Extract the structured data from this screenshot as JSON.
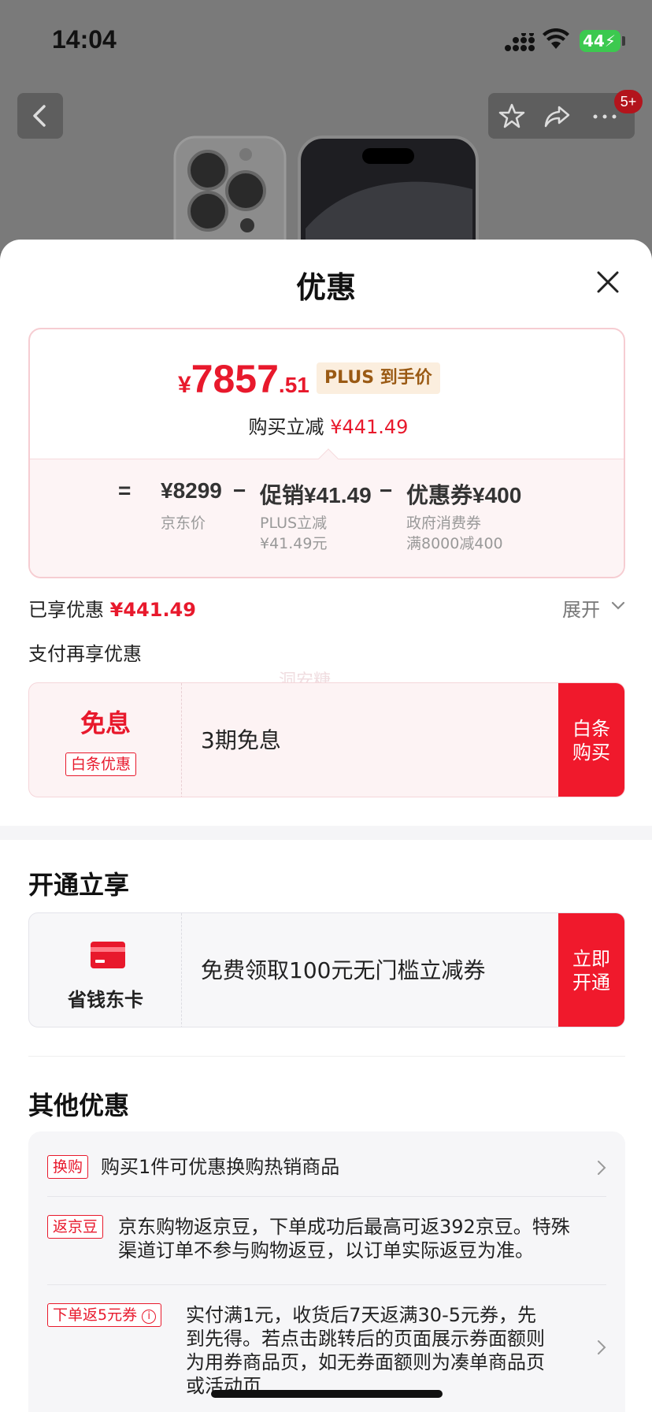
{
  "status": {
    "time": "14:04",
    "battery": "44"
  },
  "nav": {
    "badge": "5+"
  },
  "sheet": {
    "title": "优惠"
  },
  "price_card": {
    "symbol": "¥",
    "integer": "7857",
    "decimal": ".51",
    "plus_tag": "PLUS 到手价",
    "instant_cut_label": "购买立减",
    "instant_cut_value": "¥441.49",
    "eq": "=",
    "jd_price": "¥8299",
    "minus1": "−",
    "promo": "促销¥41.49",
    "minus2": "−",
    "coupon": "优惠券¥400",
    "jd_price_label": "京东价",
    "promo_sub1": "PLUS立减",
    "promo_sub2": "¥41.49元",
    "coupon_sub1": "政府消费券",
    "coupon_sub2": "满8000减400"
  },
  "enjoyed": {
    "label": "已享优惠",
    "value": "¥441.49",
    "expand": "展开"
  },
  "pay_more": {
    "title": "支付再享优惠",
    "watermark": "洞安糖"
  },
  "baitiao": {
    "title": "免息",
    "tag": "白条优惠",
    "desc": "3期免息",
    "button_l1": "白条",
    "button_l2": "购买"
  },
  "open_section": {
    "title": "开通立享"
  },
  "card_offer": {
    "label": "省钱东卡",
    "desc": "免费领取100元无门槛立减券",
    "button_l1": "立即",
    "button_l2": "开通"
  },
  "other_section": {
    "title": "其他优惠",
    "rows": [
      {
        "tag": "换购",
        "text": "购买1件可优惠换购热销商品"
      },
      {
        "tag": "返京豆",
        "line1": "京东购物返京豆，下单成功后最高可返392京豆。特殊",
        "line2": "渠道订单不参与购物返豆，以订单实际返豆为准。"
      },
      {
        "tag": "下单返5元券",
        "line1": "实付满1元，收货后7天返满30-5元券，先",
        "line2": "到先得。若点击跳转后的页面展示券面额则",
        "line3": "为用券商品页，如无券面额则为凑单商品页",
        "line4": "或活动页"
      }
    ]
  },
  "colors": {
    "accent": "#e8192c",
    "button": "#f0192c",
    "plus_bg": "#fbeede"
  }
}
